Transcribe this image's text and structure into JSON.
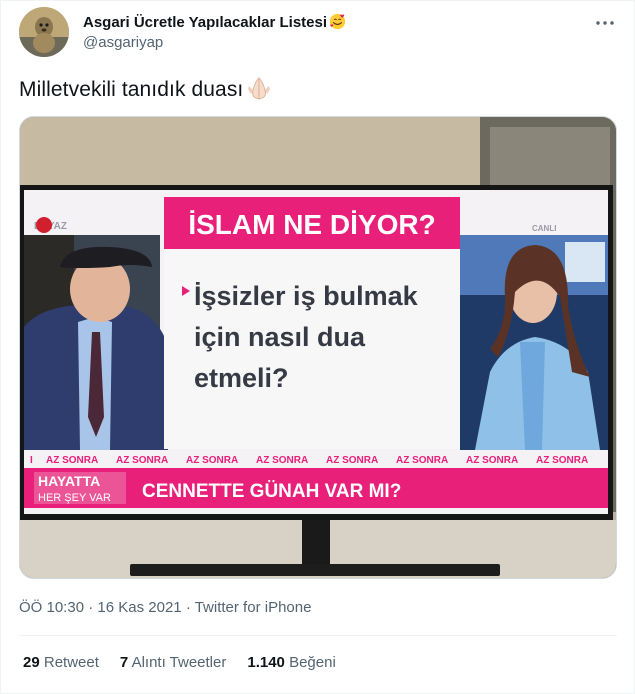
{
  "author": {
    "display_name": "Asgari Ücretle Yapılacaklar Listesi",
    "handle": "@asgariyap"
  },
  "tweet": {
    "text": "Milletvekili tanıdık duası"
  },
  "tv_screen": {
    "headline": "İSLAM NE DİYOR?",
    "question_line1": "İşsizler iş bulmak",
    "question_line2": "için nasıl dua",
    "question_line3": "etmeli?",
    "ticker_text": "AZ SONRA",
    "program_logo_top": "HAYATTA",
    "program_logo_bottom": "HER ŞEY VAR",
    "bottom_banner": "CENNETTE GÜNAH VAR MI?",
    "channel_logo": "BEYAZ",
    "corner_label": "CANLI"
  },
  "meta": {
    "time": "ÖÖ 10:30",
    "date": "16 Kas 2021",
    "separator": "·",
    "client": "Twitter for iPhone"
  },
  "stats": {
    "retweets_count": "29",
    "retweets_label": "Retweet",
    "quotes_count": "7",
    "quotes_label": "Alıntı Tweetler",
    "likes_count": "1.140",
    "likes_label": "Beğeni"
  },
  "colors": {
    "text_primary": "#0f1419",
    "text_secondary": "#536471",
    "tv_pink": "#e8207a",
    "tv_white": "#f4f2f5"
  }
}
